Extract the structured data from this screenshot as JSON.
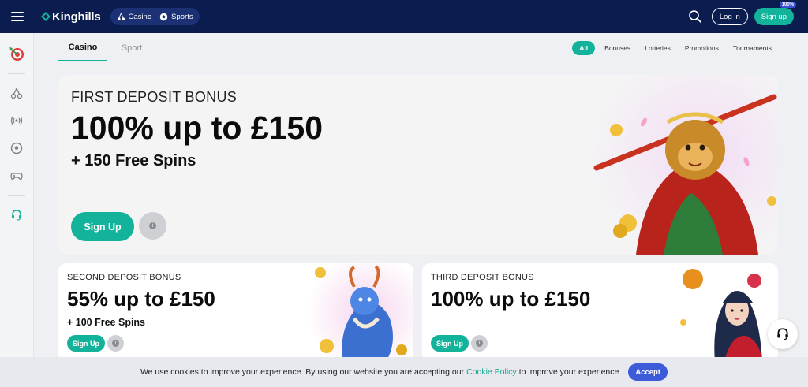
{
  "header": {
    "brand": "Kinghills",
    "modes": [
      {
        "label": "Casino",
        "icon": "cherries-icon"
      },
      {
        "label": "Sports",
        "icon": "football-icon"
      }
    ],
    "login_label": "Log in",
    "signup_label": "Sign up",
    "signup_badge": "100%"
  },
  "sidebar": {
    "items": [
      "target-icon",
      "cherries-icon",
      "live-icon",
      "football-icon",
      "gamepad-icon",
      "headset-icon"
    ]
  },
  "tabs": [
    {
      "label": "Casino",
      "active": true
    },
    {
      "label": "Sport",
      "active": false
    }
  ],
  "filters": [
    {
      "label": "All",
      "active": true
    },
    {
      "label": "Bonuses",
      "active": false
    },
    {
      "label": "Lotteries",
      "active": false
    },
    {
      "label": "Promotions",
      "active": false
    },
    {
      "label": "Tournaments",
      "active": false
    }
  ],
  "hero": {
    "kicker": "FIRST DEPOSIT BONUS",
    "title": "100% up to £150",
    "subtitle": "+ 150 Free Spins",
    "signup_label": "Sign Up"
  },
  "cards": [
    {
      "kicker": "SECOND DEPOSIT BONUS",
      "title": "55% up to £150",
      "subtitle": "+ 100 Free Spins",
      "signup_label": "Sign Up"
    },
    {
      "kicker": "THIRD DEPOSIT BONUS",
      "title": "100% up to £150",
      "subtitle": "",
      "signup_label": "Sign Up"
    }
  ],
  "info_glyph": "i",
  "cookie": {
    "text_before": "We use cookies to improve your experience. By using our website you are accepting our",
    "link": "Cookie Policy",
    "text_after": "to improve your experience",
    "accept_label": "Accept"
  },
  "colors": {
    "header": "#0b1d4f",
    "accent": "#12b39a",
    "accept": "#3b5bd9"
  }
}
